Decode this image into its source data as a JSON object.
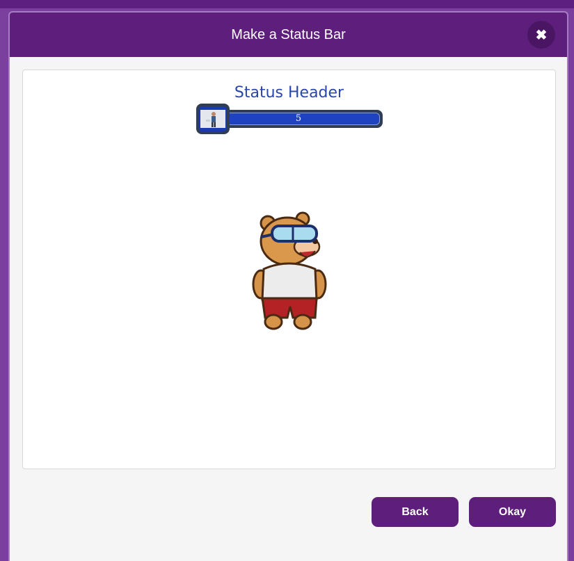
{
  "dialog": {
    "title": "Make a Status Bar",
    "close_symbol": "✖"
  },
  "preview": {
    "status_header": "Status Header",
    "status_bar": {
      "value": "5",
      "fill_fraction": 1.0,
      "icon": "person-thumbnail-icon",
      "track_color": "#1f42c0",
      "frame_color": "#2f3d55"
    },
    "sprite": "bear-with-goggles-sprite"
  },
  "footer": {
    "back_label": "Back",
    "okay_label": "Okay"
  },
  "colors": {
    "accent": "#5e1e7c",
    "header_text": "#2a46a8"
  }
}
